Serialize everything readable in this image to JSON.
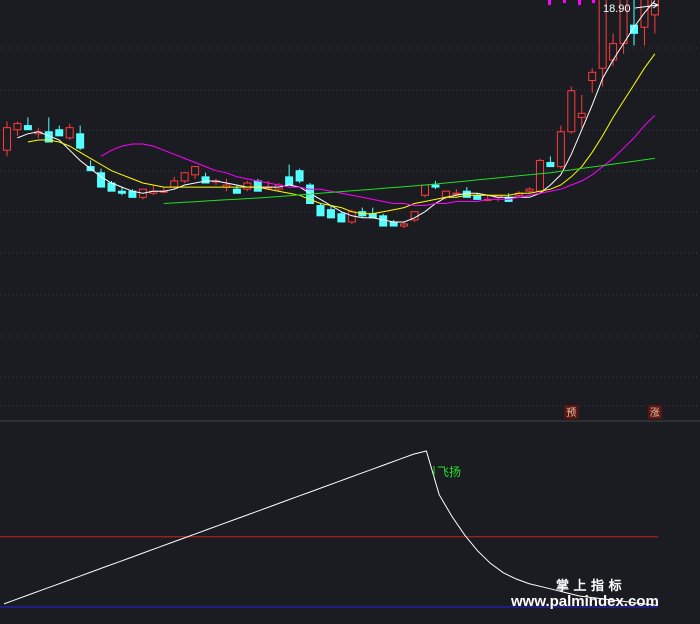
{
  "chart_data": [
    {
      "type": "candlestick",
      "price_label": "18.90",
      "markers": [
        {
          "text": "预",
          "index": 54
        },
        {
          "text": "涨",
          "index": 62
        }
      ],
      "candles": [
        [
          10.6,
          12.0,
          10.3,
          11.7
        ],
        [
          11.6,
          12.0,
          11.3,
          11.9
        ],
        [
          11.8,
          12.2,
          11.6,
          11.6
        ],
        [
          11.4,
          11.7,
          11.2,
          11.5
        ],
        [
          11.5,
          12.2,
          11.4,
          11.0
        ],
        [
          11.6,
          11.8,
          11.4,
          11.3
        ],
        [
          11.2,
          11.9,
          11.1,
          11.7
        ],
        [
          11.4,
          11.8,
          10.6,
          10.7
        ],
        [
          9.8,
          10.1,
          9.7,
          9.6
        ],
        [
          9.5,
          9.7,
          9.4,
          8.8
        ],
        [
          9.0,
          9.1,
          8.9,
          8.6
        ],
        [
          8.6,
          8.8,
          8.4,
          8.5
        ],
        [
          8.6,
          8.7,
          8.4,
          8.3
        ],
        [
          8.3,
          8.6,
          8.2,
          8.7
        ],
        [
          8.5,
          8.9,
          8.4,
          8.6
        ],
        [
          8.6,
          8.8,
          8.5,
          8.6
        ],
        [
          8.8,
          9.3,
          8.7,
          9.1
        ],
        [
          9.1,
          9.5,
          9.0,
          9.5
        ],
        [
          9.4,
          9.6,
          9.2,
          9.8
        ],
        [
          9.3,
          9.5,
          9.2,
          9.0
        ],
        [
          9.1,
          9.2,
          8.9,
          9.1
        ],
        [
          8.8,
          9.2,
          8.6,
          8.9
        ],
        [
          8.7,
          8.9,
          8.6,
          8.5
        ],
        [
          8.7,
          9.1,
          8.6,
          9.0
        ],
        [
          9.1,
          9.2,
          8.6,
          8.6
        ],
        [
          8.8,
          9.1,
          8.7,
          8.8
        ],
        [
          8.7,
          9.0,
          8.6,
          8.9
        ],
        [
          9.3,
          9.9,
          9.2,
          8.9
        ],
        [
          9.6,
          9.7,
          9.0,
          9.1
        ],
        [
          8.9,
          9.0,
          8.5,
          8.0
        ],
        [
          7.9,
          8.0,
          7.6,
          7.4
        ],
        [
          7.7,
          7.9,
          7.6,
          7.3
        ],
        [
          7.5,
          7.6,
          7.2,
          7.1
        ],
        [
          7.1,
          7.7,
          7.0,
          7.6
        ],
        [
          7.6,
          7.8,
          7.3,
          7.4
        ],
        [
          7.5,
          7.8,
          7.4,
          7.3
        ],
        [
          7.4,
          7.5,
          7.0,
          6.9
        ],
        [
          7.1,
          7.2,
          6.9,
          6.9
        ],
        [
          6.9,
          7.1,
          6.8,
          7.0
        ],
        [
          7.2,
          7.6,
          7.1,
          7.6
        ],
        [
          8.4,
          8.6,
          8.3,
          8.9
        ],
        [
          8.9,
          9.1,
          8.7,
          8.8
        ],
        [
          8.3,
          8.6,
          8.2,
          8.6
        ],
        [
          8.5,
          8.7,
          8.4,
          8.5
        ],
        [
          8.6,
          8.8,
          8.5,
          8.3
        ],
        [
          8.4,
          8.5,
          8.2,
          8.2
        ],
        [
          8.2,
          8.4,
          8.1,
          8.2
        ],
        [
          8.3,
          8.4,
          8.1,
          8.4
        ],
        [
          8.3,
          8.5,
          8.2,
          8.1
        ],
        [
          8.4,
          8.6,
          8.3,
          8.5
        ],
        [
          8.6,
          8.8,
          8.5,
          8.7
        ],
        [
          8.6,
          10.2,
          8.5,
          10.1
        ],
        [
          10.0,
          10.3,
          9.9,
          9.8
        ],
        [
          9.8,
          11.8,
          9.7,
          11.5
        ],
        [
          11.5,
          13.7,
          11.4,
          13.5
        ],
        [
          12.2,
          13.3,
          11.7,
          12.4
        ],
        [
          14.0,
          14.6,
          13.4,
          14.4
        ],
        [
          14.6,
          18.3,
          13.7,
          18.2
        ],
        [
          15.0,
          16.3,
          14.7,
          15.8
        ],
        [
          15.8,
          18.3,
          15.3,
          18.0
        ],
        [
          16.7,
          18.7,
          15.7,
          16.3
        ],
        [
          16.6,
          18.6,
          15.7,
          18.3
        ],
        [
          17.2,
          18.9,
          16.3,
          18.5
        ]
      ],
      "ma_series": [
        {
          "color": "#ffffff",
          "values": [
            11.2,
            11.4,
            11.5,
            11.3,
            11.1,
            10.6,
            10.1,
            9.7,
            9.3,
            9.0,
            8.8,
            8.6,
            8.5,
            8.6,
            8.6,
            8.7,
            8.9,
            9.0,
            9.1,
            9.1,
            9.0,
            8.9,
            8.8,
            8.8,
            8.8,
            8.8,
            8.9,
            8.8,
            8.5,
            8.2,
            7.9,
            7.6,
            7.4,
            7.3,
            7.3,
            7.2,
            7.1,
            7.1,
            7.3,
            7.6,
            8.0,
            8.3,
            8.4,
            8.5,
            8.5,
            8.4,
            8.3,
            8.3,
            8.3,
            8.3,
            8.5,
            8.9,
            9.4,
            10.4,
            11.6,
            12.8,
            14.1,
            15.0,
            15.8,
            16.6,
            17.3,
            17.9
          ]
        },
        {
          "color": "#ffff00",
          "values": [
            11.0,
            11.1,
            11.1,
            11.0,
            10.8,
            10.5,
            10.2,
            9.9,
            9.6,
            9.4,
            9.2,
            9.0,
            8.9,
            8.8,
            8.8,
            8.8,
            8.8,
            8.8,
            8.8,
            8.8,
            8.8,
            8.8,
            8.8,
            8.7,
            8.6,
            8.5,
            8.4,
            8.2,
            8.0,
            7.9,
            7.8,
            7.6,
            7.5,
            7.5,
            7.6,
            7.7,
            7.8,
            8.0,
            8.1,
            8.2,
            8.3,
            8.3,
            8.4,
            8.4,
            8.4,
            8.4,
            8.4,
            8.5,
            8.5,
            8.6,
            8.7,
            8.9,
            9.3,
            9.8,
            10.5,
            11.3,
            12.2,
            13.0,
            13.8,
            14.6,
            15.3
          ]
        },
        {
          "color": "#ff00ff",
          "values": [
            10.3,
            10.6,
            10.8,
            10.9,
            10.9,
            10.8,
            10.6,
            10.4,
            10.2,
            10.0,
            9.8,
            9.6,
            9.5,
            9.3,
            9.2,
            9.1,
            9.0,
            8.9,
            8.8,
            8.8,
            8.7,
            8.7,
            8.6,
            8.5,
            8.4,
            8.3,
            8.2,
            8.1,
            8.0,
            8.0,
            7.9,
            7.9,
            8.0,
            8.0,
            8.1,
            8.1,
            8.1,
            8.2,
            8.2,
            8.2,
            8.3,
            8.4,
            8.5,
            8.6,
            8.7,
            8.9,
            9.1,
            9.4,
            9.8,
            10.2,
            10.7,
            11.2,
            11.8,
            12.3
          ]
        },
        {
          "color": "#22dd22",
          "values": [
            8.0,
            8.03,
            8.06,
            8.09,
            8.12,
            8.15,
            8.18,
            8.21,
            8.24,
            8.27,
            8.3,
            8.34,
            8.38,
            8.42,
            8.46,
            8.5,
            8.54,
            8.58,
            8.62,
            8.66,
            8.7,
            8.74,
            8.78,
            8.82,
            8.86,
            8.9,
            8.95,
            9.0,
            9.05,
            9.1,
            9.15,
            9.2,
            9.25,
            9.3,
            9.35,
            9.4,
            9.45,
            9.5,
            9.57,
            9.64,
            9.71,
            9.78,
            9.85,
            9.92,
            9.99,
            10.06,
            10.13,
            10.2
          ]
        }
      ]
    },
    {
      "type": "line",
      "label": "飞扬",
      "indicator_values": [
        2,
        5,
        8,
        11,
        14,
        17,
        20,
        23,
        26,
        29,
        32,
        35,
        38,
        41,
        44,
        47,
        50,
        53,
        56,
        59,
        62,
        65,
        68,
        71,
        74,
        77,
        80,
        83,
        86,
        89,
        92,
        95,
        98,
        100,
        72,
        58,
        46,
        36,
        28,
        22,
        18,
        15,
        13,
        11,
        9,
        7,
        6,
        5,
        4,
        3,
        2,
        1
      ],
      "levels": [
        {
          "value": 45,
          "color": "#cc2222"
        },
        {
          "value": 0,
          "color": "#2222dd"
        }
      ]
    }
  ],
  "watermark": {
    "cn": "掌 上 指 标",
    "url": "www.palmindex.com"
  }
}
